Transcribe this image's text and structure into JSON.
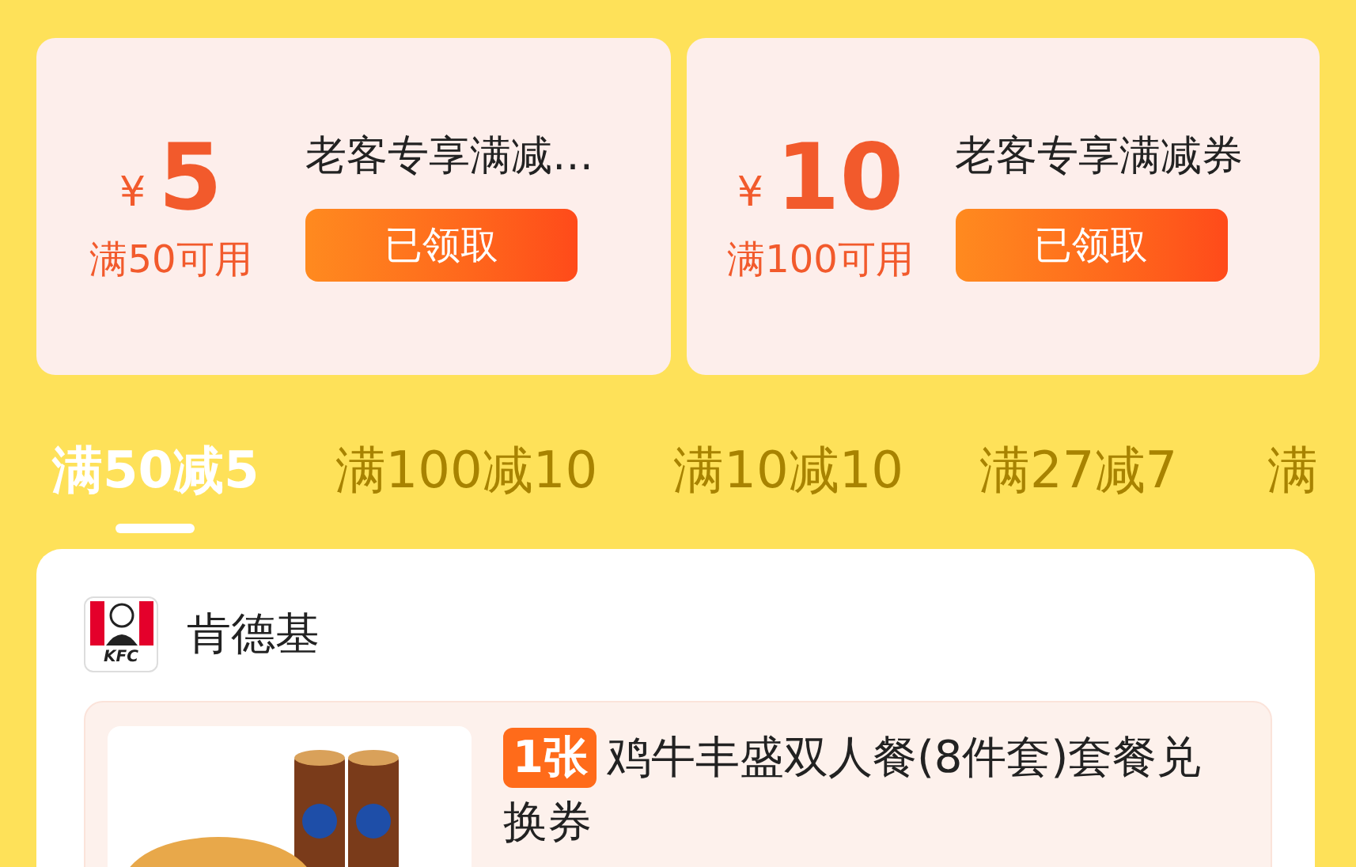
{
  "coupons": [
    {
      "currency": "¥",
      "amount": "5",
      "condition": "满50可用",
      "title": "老客专享满减…",
      "button": "已领取",
      "claimed": true
    },
    {
      "currency": "¥",
      "amount": "10",
      "condition": "满100可用",
      "title": "老客专享满减券",
      "button": "已领取",
      "claimed": true
    }
  ],
  "tabs": [
    {
      "label": "满50减5",
      "selected": true
    },
    {
      "label": "满100减10",
      "selected": false
    },
    {
      "label": "满10减10",
      "selected": false
    },
    {
      "label": "满27减7",
      "selected": false
    },
    {
      "label": "满",
      "selected": false
    }
  ],
  "store": {
    "name": "肯德基",
    "logo_text": "KFC"
  },
  "product": {
    "kind": "picture",
    "count": "1张",
    "title": "鸡牛丰盛双人餐(8件套)套餐兑换券"
  }
}
